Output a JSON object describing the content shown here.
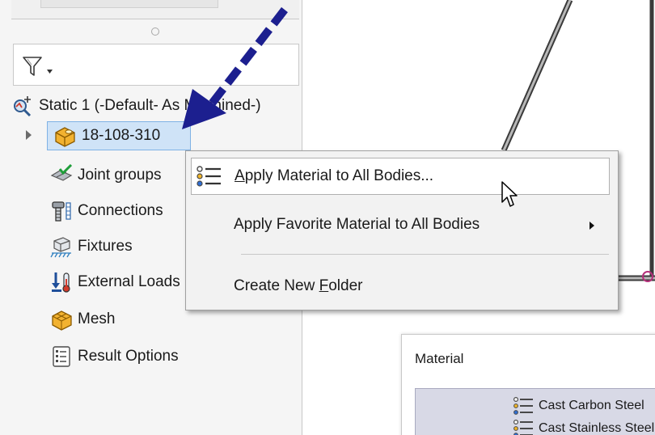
{
  "tree": {
    "study": "Static 1 (-Default- As Machined-)",
    "part": "18-108-310",
    "items": [
      {
        "label": "Joint groups",
        "icon": "joint-groups-icon"
      },
      {
        "label": "Connections",
        "icon": "connections-icon"
      },
      {
        "label": "Fixtures",
        "icon": "fixtures-icon"
      },
      {
        "label": "External Loads",
        "icon": "external-loads-icon"
      },
      {
        "label": "Mesh",
        "icon": "mesh-icon"
      },
      {
        "label": "Result Options",
        "icon": "result-options-icon"
      }
    ]
  },
  "context_menu": {
    "items": [
      {
        "label_prefix": "",
        "accel": "A",
        "label_rest": "pply Material to All Bodies...",
        "icon": "material-list-icon",
        "hover": true
      },
      {
        "label_prefix": "Apply Favorite Material to All Bodies",
        "accel": "",
        "label_rest": "",
        "submenu": true
      },
      {
        "label_prefix": "Create New ",
        "accel": "F",
        "label_rest": "older"
      }
    ]
  },
  "material_dialog": {
    "title": "Material",
    "rows": [
      "Cast Carbon Steel",
      "Cast Stainless Steel"
    ]
  },
  "colors": {
    "accent_arrow": "#1c1f8f",
    "selection": "#cfe3f7",
    "menu_bg": "#f2f2f2",
    "material_list_bg": "#d8d9e6",
    "node_magenta": "#b4307a"
  }
}
